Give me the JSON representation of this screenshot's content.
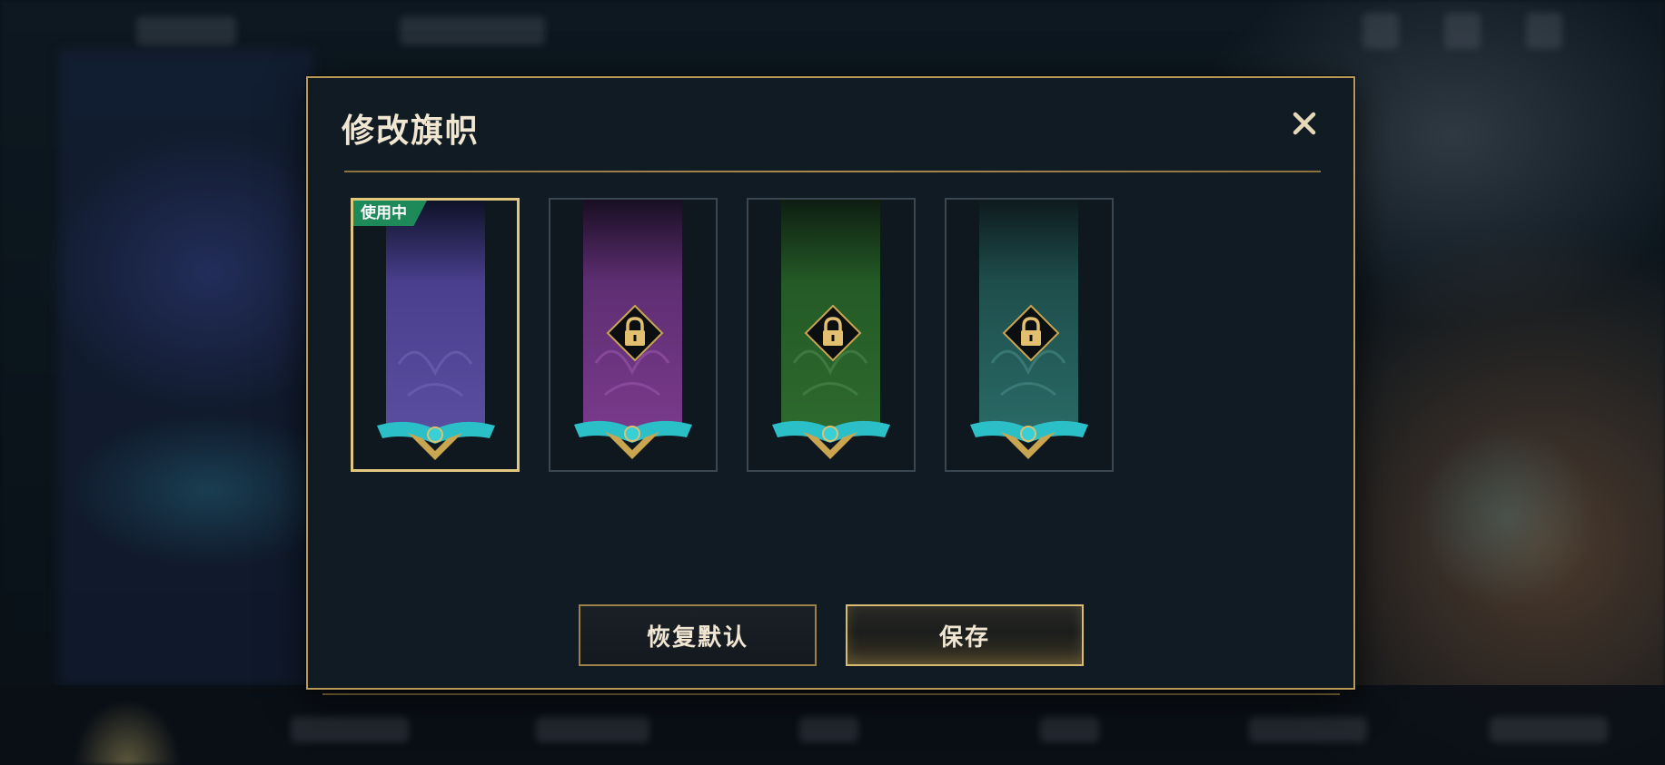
{
  "dialog": {
    "title": "修改旗帜",
    "close_icon": "close-icon",
    "in_use_label": "使用中",
    "banners": [
      {
        "name": "purple-banner",
        "color": "#5a4ea0",
        "selected": true,
        "locked": false
      },
      {
        "name": "magenta-banner",
        "color": "#7a3a8c",
        "selected": false,
        "locked": true
      },
      {
        "name": "green-banner",
        "color": "#2e6a2e",
        "selected": false,
        "locked": true
      },
      {
        "name": "teal-banner",
        "color": "#2a6a66",
        "selected": false,
        "locked": true
      }
    ],
    "reset_label": "恢复默认",
    "save_label": "保存"
  },
  "colors": {
    "gold_border": "#b89a56",
    "selected_border": "#e2c87c",
    "in_use_green": "#1e8a5a",
    "text": "#f0e6d2",
    "panel": "#111b23"
  }
}
